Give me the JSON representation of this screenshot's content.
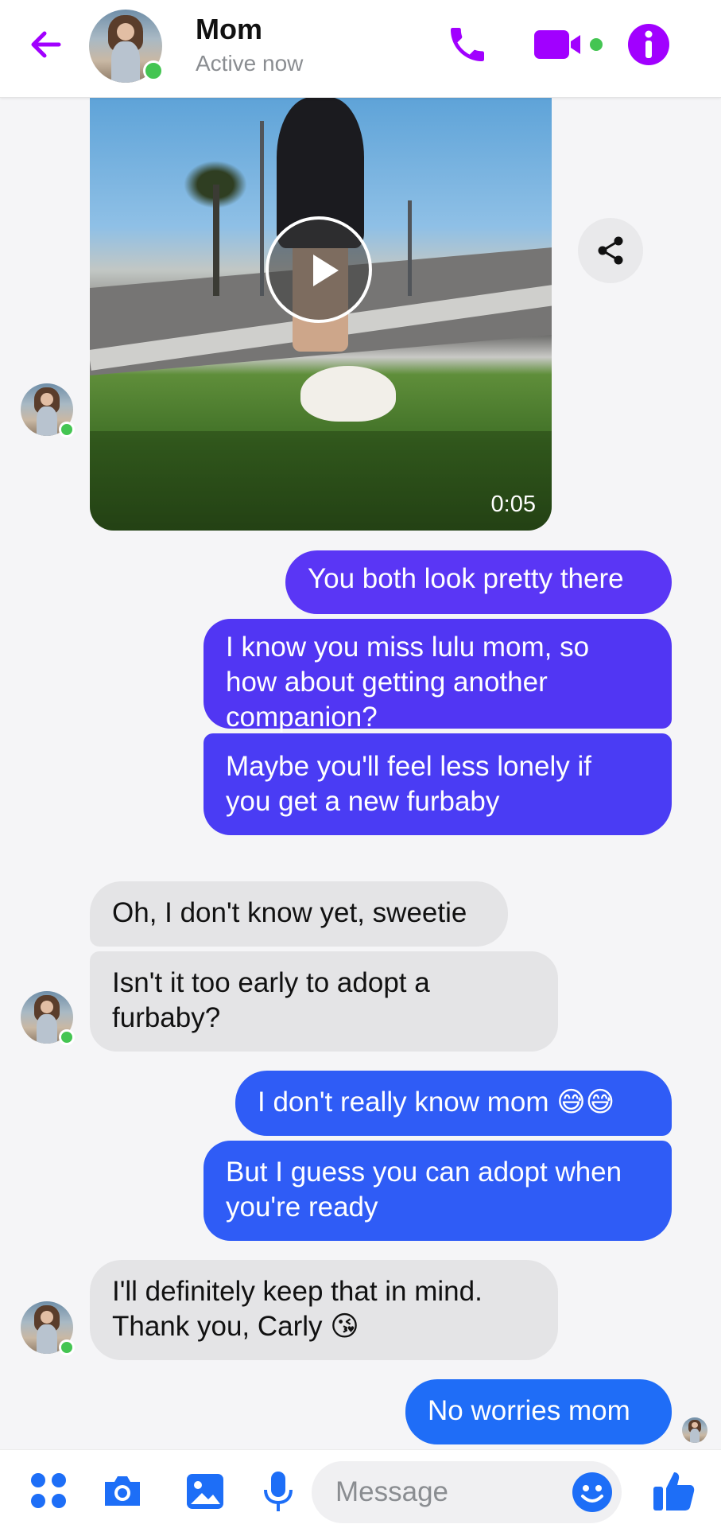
{
  "header": {
    "contact_name": "Mom",
    "status": "Active now",
    "accent_color": "#a100ff"
  },
  "video_message": {
    "duration": "0:05"
  },
  "messages": [
    {
      "id": "m1",
      "direction": "outgoing",
      "text": "You both look pretty there",
      "color": "#5a36f5"
    },
    {
      "id": "m2",
      "direction": "outgoing",
      "lines": [
        "I know you miss lulu mom, so",
        "how about getting another",
        "companion?"
      ],
      "color": "#5136f3"
    },
    {
      "id": "m3",
      "direction": "outgoing",
      "lines": [
        "Maybe you'll feel less lonely if",
        "you get a new furbaby"
      ],
      "color": "#4a3cf4"
    },
    {
      "id": "m4",
      "direction": "incoming",
      "text": "Oh, I don't know yet, sweetie"
    },
    {
      "id": "m5",
      "direction": "incoming",
      "lines": [
        "Isn't it too early to adopt a",
        "furbaby?"
      ]
    },
    {
      "id": "m6",
      "direction": "outgoing",
      "text": "I don't really know mom",
      "emoji": "😅😅",
      "color": "#2f5cf6"
    },
    {
      "id": "m7",
      "direction": "outgoing",
      "lines": [
        "But I guess you can adopt when",
        "you're ready"
      ],
      "color": "#2f5cf6"
    },
    {
      "id": "m8",
      "direction": "incoming",
      "lines": [
        "I'll definitely keep that in mind.",
        "Thank you, Carly"
      ],
      "emoji": "😘"
    },
    {
      "id": "m9",
      "direction": "outgoing",
      "text": "No worries mom",
      "color": "#1f6df7"
    }
  ],
  "composer": {
    "placeholder": "Message",
    "icon_color": "#1d6ef7"
  },
  "icons": [
    "back-arrow-icon",
    "phone-icon",
    "video-call-icon",
    "info-icon",
    "share-icon",
    "play-icon",
    "menu-dots-icon",
    "camera-icon",
    "gallery-icon",
    "microphone-icon",
    "emoji-icon",
    "thumbs-up-icon"
  ]
}
